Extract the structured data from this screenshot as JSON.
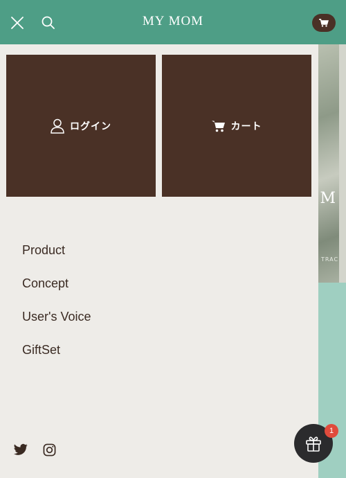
{
  "header": {
    "logo": "MY MOM",
    "close_icon": "close-icon",
    "search_icon": "search-icon",
    "cart_icon": "cart-icon"
  },
  "background": {
    "hero_mark": "M",
    "hero_tag": "TRAC"
  },
  "drawer": {
    "tiles": [
      {
        "label": "ログイン",
        "icon": "user-icon"
      },
      {
        "label": "カート",
        "icon": "cart-icon"
      }
    ],
    "menu": [
      {
        "label": "Product"
      },
      {
        "label": "Concept"
      },
      {
        "label": "User's Voice"
      },
      {
        "label": "GiftSet"
      }
    ],
    "social": [
      {
        "icon": "twitter-icon"
      },
      {
        "icon": "instagram-icon"
      }
    ]
  },
  "gift": {
    "icon": "gift-icon",
    "badge_count": "1"
  },
  "colors": {
    "header": "#4e9e86",
    "tile": "#4a3126",
    "drawer_bg": "#eeece8",
    "badge": "#e04b3c"
  }
}
